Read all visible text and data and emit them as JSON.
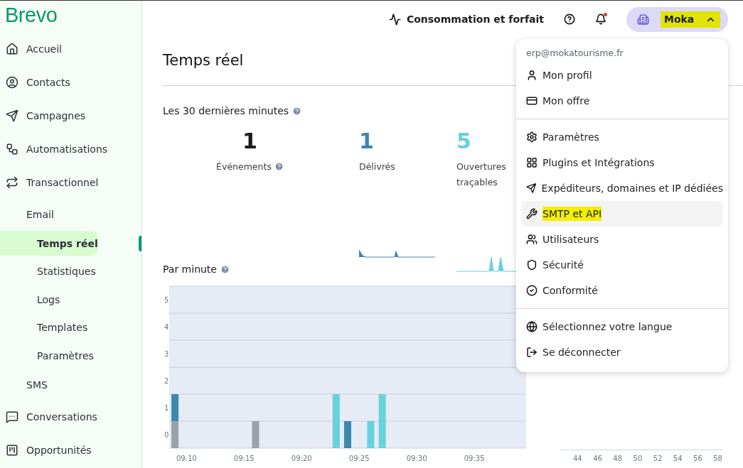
{
  "sidebar": {
    "logo": "Brevo",
    "items": [
      {
        "label": "Accueil",
        "selected": false
      },
      {
        "label": "Contacts",
        "selected": false
      },
      {
        "label": "Campagnes",
        "selected": false
      },
      {
        "label": "Automatisations",
        "selected": false
      },
      {
        "label": "Transactionnel",
        "selected": false,
        "children": [
          {
            "label": "Email",
            "selected": false,
            "children": [
              {
                "label": "Temps réel",
                "selected": true
              },
              {
                "label": "Statistiques",
                "selected": false
              },
              {
                "label": "Logs",
                "selected": false
              },
              {
                "label": "Templates",
                "selected": false
              },
              {
                "label": "Paramètres",
                "selected": false
              }
            ]
          },
          {
            "label": "SMS",
            "selected": false
          }
        ]
      },
      {
        "label": "Conversations",
        "selected": false
      },
      {
        "label": "Opportunités",
        "selected": false
      }
    ]
  },
  "top_bar": {
    "usage_link": "Consommation et forfait",
    "notifications_unread": true,
    "account": {
      "label": "Moka",
      "expanded": true,
      "highlighted": true
    }
  },
  "page": {
    "title": "Temps réel",
    "section_title": "Les 30 dernières minutes",
    "stats": [
      {
        "value": "1",
        "label": "Événements",
        "color": "#1b1b1b",
        "has_help": true,
        "kind": "plain"
      },
      {
        "value": "1",
        "label": "Délivrés",
        "color": "#3f86ae",
        "has_help": false,
        "kind": "trend"
      },
      {
        "value": "5",
        "label": "Ouvertures traçables",
        "color": "#65d2dc",
        "has_help": false,
        "kind": "trend"
      }
    ],
    "per_minute": {
      "title": "Par minute",
      "chart_data": {
        "type": "bar",
        "stacked": true,
        "categories": [
          null,
          "09:10",
          null,
          null,
          null,
          null,
          "09:15",
          null,
          null,
          null,
          null,
          "09:20",
          null,
          null,
          null,
          null,
          "09:25",
          null,
          null,
          null,
          null,
          "09:30",
          null,
          null,
          null,
          null,
          "09:35",
          null,
          null,
          null,
          null
        ],
        "series": [
          {
            "color": "#9aa1ab",
            "values": [
              1,
              null,
              null,
              null,
              null,
              null,
              null,
              1,
              null,
              null,
              null,
              null,
              null,
              null,
              null,
              null,
              null,
              null,
              null,
              null,
              null,
              null,
              null,
              null,
              null,
              null,
              null,
              null,
              null,
              null,
              null
            ]
          },
          {
            "color": "#3f86ae",
            "values": [
              1,
              null,
              null,
              null,
              null,
              null,
              null,
              null,
              null,
              null,
              null,
              null,
              null,
              null,
              null,
              1,
              null,
              null,
              null,
              null,
              null,
              null,
              null,
              null,
              null,
              null,
              null,
              null,
              null,
              null,
              null
            ]
          },
          {
            "color": "#65d2dc",
            "values": [
              null,
              null,
              null,
              null,
              null,
              null,
              null,
              null,
              null,
              null,
              null,
              null,
              null,
              null,
              2,
              null,
              null,
              1,
              2,
              null,
              null,
              null,
              null,
              null,
              null,
              null,
              null,
              null,
              null,
              null,
              null
            ]
          }
        ],
        "ylim": [
          0,
          6
        ],
        "yticks": [
          {
            "value": 0.5,
            "label": "0"
          },
          {
            "value": 1.5,
            "label": "1"
          },
          {
            "value": 2.5,
            "label": "2"
          },
          {
            "value": 3.5,
            "label": "3"
          },
          {
            "value": 4.5,
            "label": "4"
          },
          {
            "value": 5.5,
            "label": "5"
          }
        ]
      }
    },
    "side_chart": {
      "axis_labels": [
        "44",
        "46",
        "48",
        "50",
        "52",
        "54",
        "56",
        "58"
      ]
    }
  },
  "account_menu": {
    "email": "erp@mokatourisme.fr",
    "groups": [
      [
        {
          "label": "Mon profil",
          "hovered": false,
          "highlighted": false
        },
        {
          "label": "Mon offre",
          "hovered": false,
          "highlighted": false
        }
      ],
      [
        {
          "label": "Paramètres",
          "hovered": false,
          "highlighted": false
        },
        {
          "label": "Plugins et Intégrations",
          "hovered": false,
          "highlighted": false
        },
        {
          "label": "Expéditeurs, domaines et IP dédiées",
          "hovered": false,
          "highlighted": false
        },
        {
          "label": "SMTP et API",
          "hovered": true,
          "highlighted": true
        },
        {
          "label": "Utilisateurs",
          "hovered": false,
          "highlighted": false
        },
        {
          "label": "Sécurité",
          "hovered": false,
          "highlighted": false
        },
        {
          "label": "Conformité",
          "hovered": false,
          "highlighted": false
        }
      ],
      [
        {
          "label": "Sélectionnez votre langue",
          "hovered": false,
          "highlighted": false
        },
        {
          "label": "Se déconnecter",
          "hovered": false,
          "highlighted": false
        }
      ]
    ]
  }
}
